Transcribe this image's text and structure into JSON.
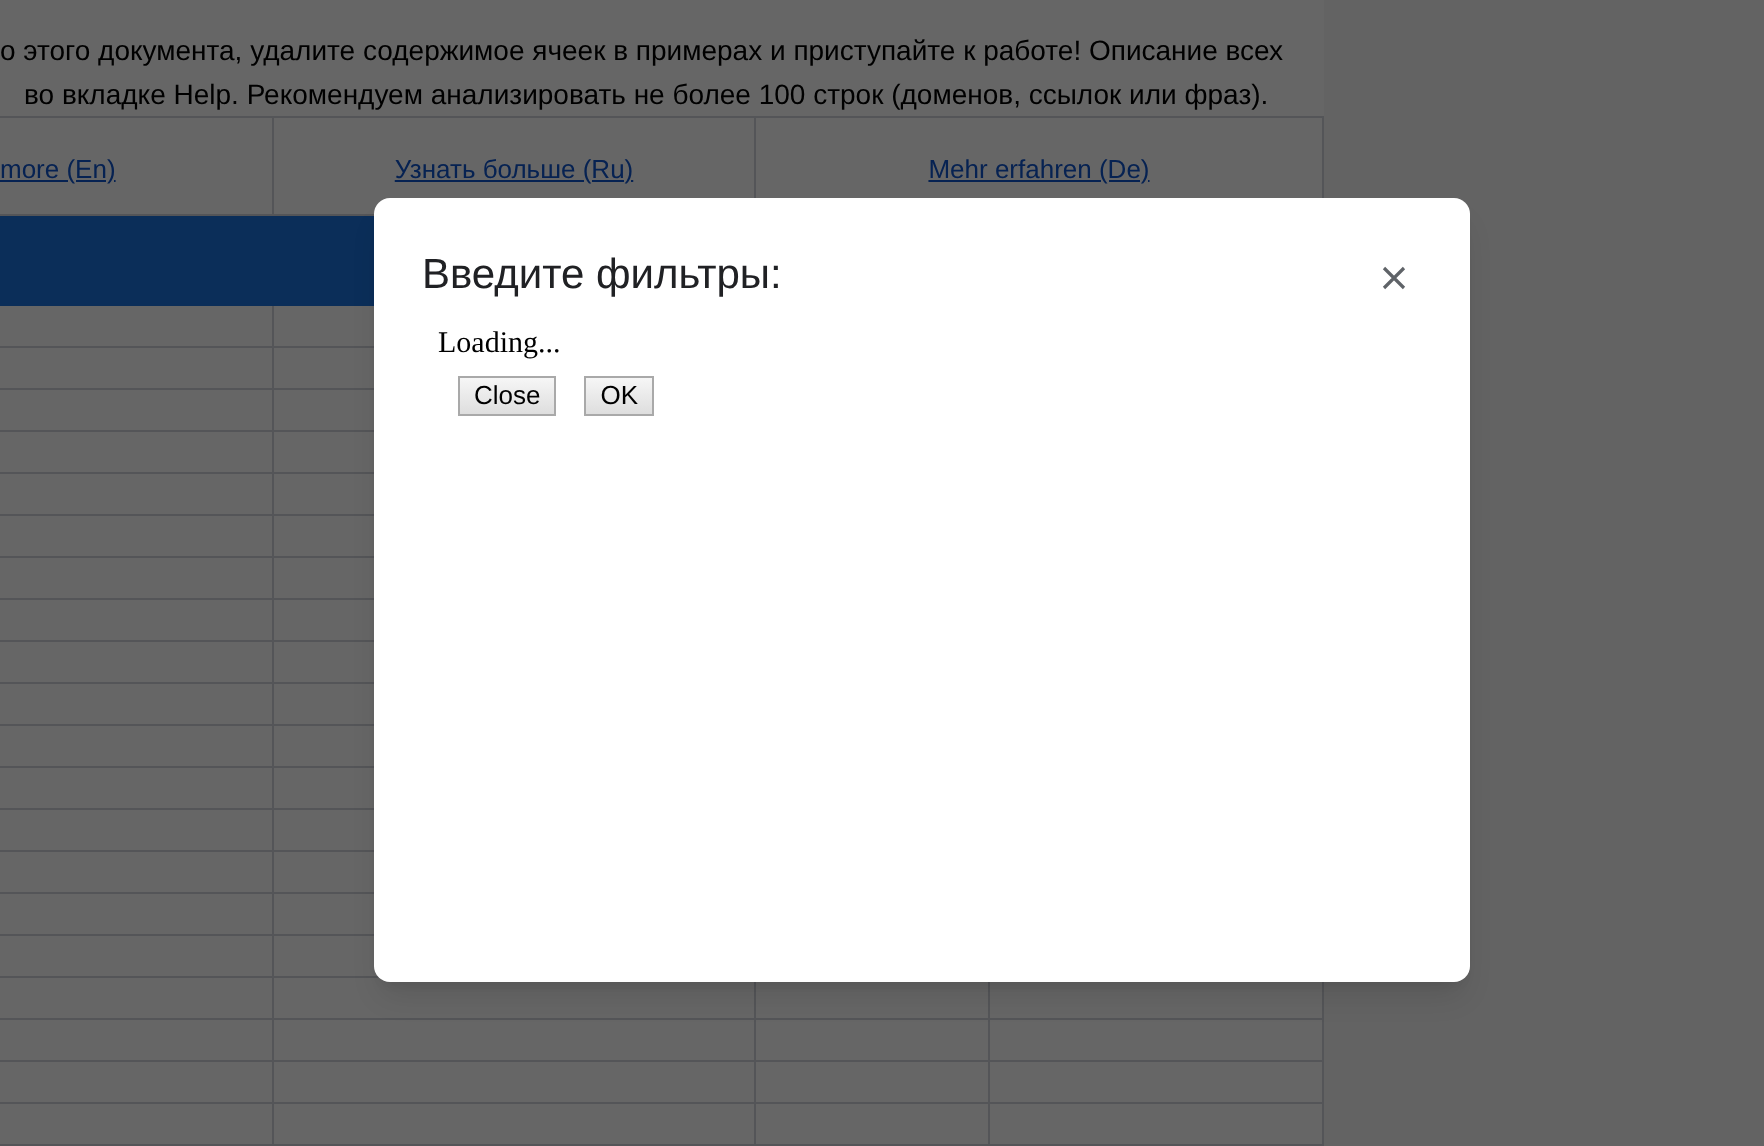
{
  "sheet": {
    "intro_lines": [
      "о этого документа, удалите содержимое ячеек в примерах и приступайте к работе! Описание всех",
      "во вкладке Help. Рекомендуем анализировать не более 100 строк (доменов, ссылок или фраз)."
    ],
    "links": [
      {
        "label": "more (En)"
      },
      {
        "label": "Узнать больше (Ru)"
      },
      {
        "label": "Mehr erfahren (De)"
      }
    ]
  },
  "dialog": {
    "title": "Введите фильтры:",
    "status": "Loading...",
    "buttons": [
      {
        "label": "Close"
      },
      {
        "label": "OK"
      }
    ]
  }
}
